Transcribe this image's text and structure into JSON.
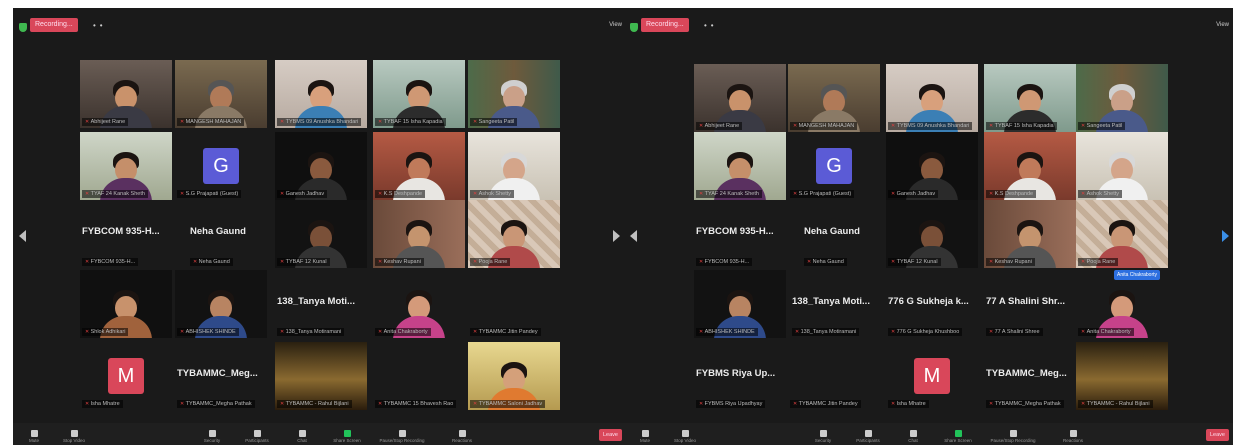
{
  "left": {
    "recording": "Recording...",
    "view_label": "View",
    "r1": [
      "Abhijeet Rane",
      "MANGESH MAHAJAN",
      "TYBMS 09 Anushka Bhandari",
      "TYBAF 15 Isha Kapadia",
      "Sangeeta Patil"
    ],
    "r2": [
      "TYAF 24 Kanak Sheth",
      "G",
      "S.G Prajapati (Guest)",
      "Ganesh Jadhav",
      "K.S Deshpande",
      "Ashok Shetty"
    ],
    "r3": [
      "FYBCOM 935-H...",
      "FYBCOM 935-H...",
      "Neha Gaund",
      "Neha Gaund",
      "TYBAF 12 Kunal",
      "Keshav Rupani",
      "Pooja Rane"
    ],
    "r4": [
      "Shlok Adhikari",
      "ABHISHEK SHINDE",
      "138_Tanya Moti...",
      "138_Tanya Motiramani",
      "Anita Chakraborty",
      "TYBAMMC Jitin Pandey"
    ],
    "r5": [
      "M",
      "Isha Mhatre",
      "TYBAMMC_Meg...",
      "TYBAMMC_Megha Pathak",
      "TYBAMMC - Rahul Bijlani",
      "TYBAMMC 15 Bhavesh Rao",
      "TYBAMMC Saloni Jadhav"
    ],
    "toolbar": [
      "Mute",
      "Stop Video",
      "Security",
      "Participants",
      "Chat",
      "Share Screen",
      "Pause/Stop Recording",
      "Reactions"
    ],
    "leave": "Leave"
  },
  "right": {
    "recording": "Recording...",
    "view_label": "View",
    "r1": [
      "Abhijeet Rane",
      "MANGESH MAHAJAN",
      "TYBMS 09 Anushka Bhandari",
      "TYBAF 15 Isha Kapadia",
      "Sangeeta Patil"
    ],
    "r2": [
      "TYAF 24 Kanak Sheth",
      "G",
      "S.G Prajapati (Guest)",
      "Ganesh Jadhav",
      "K.S Deshpande",
      "Ashok Shetty"
    ],
    "r3": [
      "FYBCOM 935-H...",
      "FYBCOM 935-H...",
      "Neha Gaund",
      "Neha Gaund",
      "TYBAF 12 Kunal",
      "Keshav Rupani",
      "Pooja Rane"
    ],
    "r4": [
      "ABHISHEK SHINDE",
      "138_Tanya Moti...",
      "138_Tanya Motiramani",
      "776 G Sukheja k...",
      "776 G Sukheja Khushboo",
      "77 A Shalini Shr...",
      "77 A Shalini Shree",
      "Anita Chakraborty"
    ],
    "r5": [
      "FYBMS Riya Up...",
      "FYBMS Riya Upadhyay",
      "TYBAMMC Jitin Pandey",
      "M",
      "Isha Mhatre",
      "TYBAMMC_Meg...",
      "TYBAMMC_Megha Pathak",
      "TYBAMMC - Rahul Bijlani"
    ],
    "tooltip": "Anita Chakraborty",
    "toolbar": [
      "Mute",
      "Stop Video",
      "Security",
      "Participants",
      "Chat",
      "Share Screen",
      "Pause/Stop Recording",
      "Reactions"
    ],
    "leave": "Leave"
  },
  "colors": {
    "avatar_g": "#5b5bd6",
    "avatar_m": "#d9475a",
    "recording": "#d9475a",
    "active_speaker": "#e3e34a",
    "share": "#21c35a"
  }
}
